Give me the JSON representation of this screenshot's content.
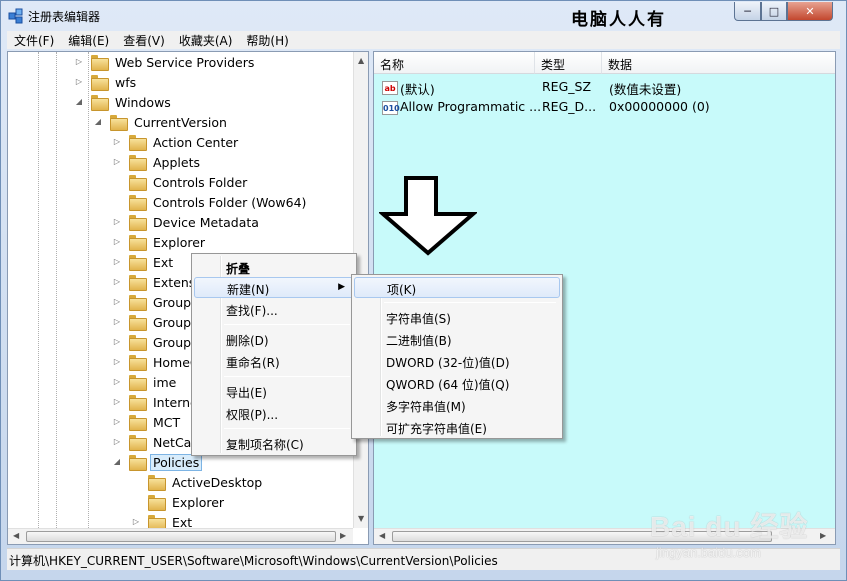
{
  "window": {
    "title": "注册表编辑器",
    "watermark": "电脑人人有",
    "min_glyph": "─",
    "max_glyph": "□",
    "close_glyph": "✕"
  },
  "menu": [
    "文件(F)",
    "编辑(E)",
    "查看(V)",
    "收藏夹(A)",
    "帮助(H)"
  ],
  "tree": [
    {
      "label": "Web Service Providers",
      "arrow": "▷"
    },
    {
      "label": "wfs",
      "arrow": "▷"
    },
    {
      "label": "Windows",
      "arrow": "◢"
    },
    {
      "label": "CurrentVersion",
      "arrow": "◢"
    },
    {
      "label": "Action Center",
      "arrow": "▷"
    },
    {
      "label": "Applets",
      "arrow": "▷"
    },
    {
      "label": "Controls Folder",
      "arrow": ""
    },
    {
      "label": "Controls Folder (Wow64)",
      "arrow": ""
    },
    {
      "label": "Device Metadata",
      "arrow": "▷"
    },
    {
      "label": "Explorer",
      "arrow": "▷"
    },
    {
      "label": "Ext",
      "arrow": "▷"
    },
    {
      "label": "Extensio",
      "arrow": "▷"
    },
    {
      "label": "Group P",
      "arrow": "▷"
    },
    {
      "label": "Group P",
      "arrow": "▷"
    },
    {
      "label": "Group P",
      "arrow": "▷"
    },
    {
      "label": "HomeG",
      "arrow": "▷"
    },
    {
      "label": "ime",
      "arrow": "▷"
    },
    {
      "label": "Internet",
      "arrow": "▷"
    },
    {
      "label": "MCT",
      "arrow": "▷"
    },
    {
      "label": "NetCach",
      "arrow": "▷"
    },
    {
      "label": "Policies",
      "arrow": "◢"
    },
    {
      "label": "ActiveDesktop",
      "arrow": ""
    },
    {
      "label": "Explorer",
      "arrow": ""
    },
    {
      "label": "Ext",
      "arrow": "▷"
    }
  ],
  "values": {
    "headers": [
      "名称",
      "类型",
      "数据"
    ],
    "rows": [
      {
        "icon": "ab",
        "name": "(默认)",
        "type": "REG_SZ",
        "data": "(数值未设置)"
      },
      {
        "icon": "010",
        "name": "Allow Programmatic ...",
        "type": "REG_D...",
        "data": "0x00000000 (0)"
      }
    ]
  },
  "context_menu": {
    "items": [
      "折叠",
      "新建(N)",
      "查找(F)...",
      "删除(D)",
      "重命名(R)",
      "导出(E)",
      "权限(P)...",
      "复制项名称(C)"
    ],
    "submenu_arrow": "▶"
  },
  "new_submenu": {
    "items": [
      "项(K)",
      "字符串值(S)",
      "二进制值(B)",
      "DWORD (32-位)值(D)",
      "QWORD (64 位)值(Q)",
      "多字符串值(M)",
      "可扩充字符串值(E)"
    ]
  },
  "status": "计算机\\HKEY_CURRENT_USER\\Software\\Microsoft\\Windows\\CurrentVersion\\Policies",
  "baidu": {
    "logo": "Bai du 经验",
    "url": "jingyan.baidu.com"
  },
  "scroll_glyphs": {
    "up": "▲",
    "down": "▼",
    "left": "◀",
    "right": "▶"
  }
}
